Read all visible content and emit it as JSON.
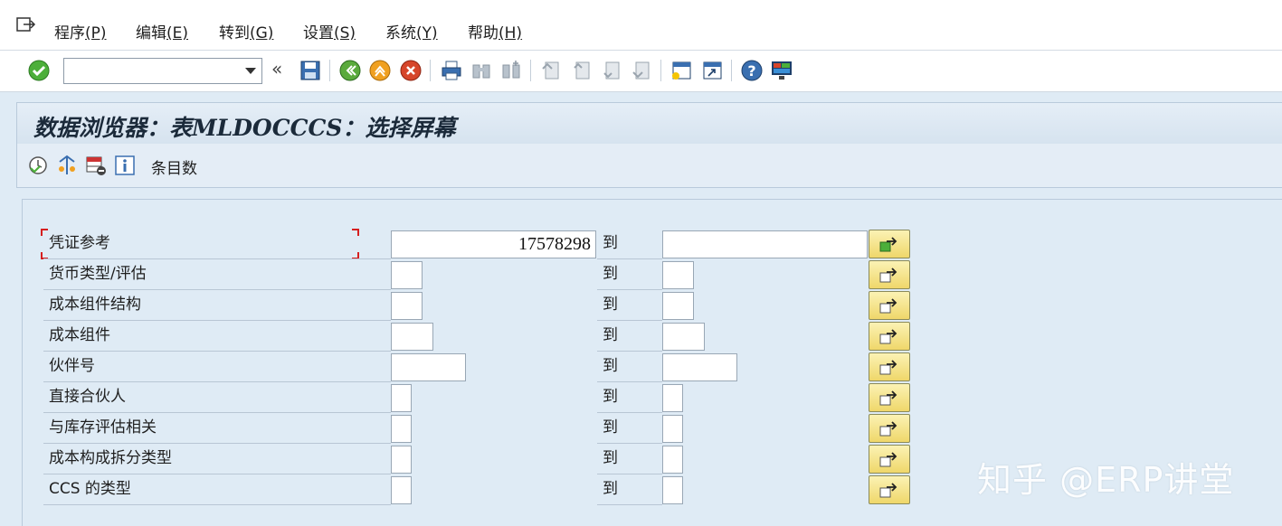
{
  "menu": {
    "items": [
      {
        "label": "程序",
        "key": "(P)"
      },
      {
        "label": "编辑",
        "key": "(E)"
      },
      {
        "label": "转到",
        "key": "(G)"
      },
      {
        "label": "设置",
        "key": "(S)"
      },
      {
        "label": "系统",
        "key": "(Y)"
      },
      {
        "label": "帮助",
        "key": "(H)"
      }
    ]
  },
  "toolbar": {
    "command_field_value": "",
    "chevron": "«"
  },
  "title": "数据浏览器：表MLDOCCCS：选择屏幕",
  "app_toolbar": {
    "entries_label": "条目数"
  },
  "selection": {
    "to_label": "到",
    "rows": [
      {
        "label": "凭证参考",
        "low": "17578298",
        "high": ""
      },
      {
        "label": "货币类型/评估",
        "low": "",
        "high": ""
      },
      {
        "label": "成本组件结构",
        "low": "",
        "high": ""
      },
      {
        "label": "成本组件",
        "low": "",
        "high": ""
      },
      {
        "label": "伙伴号",
        "low": "",
        "high": ""
      },
      {
        "label": "直接合伙人",
        "low": "",
        "high": ""
      },
      {
        "label": "与库存评估相关",
        "low": "",
        "high": ""
      },
      {
        "label": "成本构成拆分类型",
        "low": "",
        "high": ""
      },
      {
        "label": "CCS 的类型",
        "low": "",
        "high": ""
      }
    ]
  },
  "watermark": "知乎 @ERP讲堂"
}
